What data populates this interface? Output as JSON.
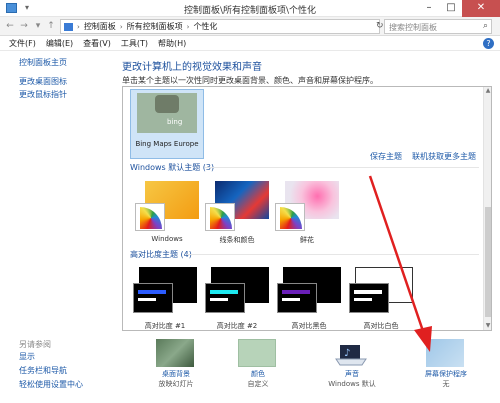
{
  "window": {
    "title": "控制面板\\所有控制面板项\\个性化"
  },
  "address": {
    "crumbs": [
      "控制面板",
      "所有控制面板项",
      "个性化"
    ],
    "search_placeholder": "搜索控制面板"
  },
  "menu": [
    "文件(F)",
    "编辑(E)",
    "查看(V)",
    "工具(T)",
    "帮助(H)"
  ],
  "sidebar": {
    "home": "控制面板主页",
    "links": [
      "更改桌面图标",
      "更改鼠标指针"
    ],
    "see_also_title": "另请参阅",
    "see_also": [
      "显示",
      "任务栏和导航",
      "轻松使用设置中心"
    ]
  },
  "main": {
    "heading": "更改计算机上的视觉效果和声音",
    "subheading": "单击某个主题以一次性同时更改桌面背景、颜色、声音和屏幕保护程序。",
    "my_theme": {
      "label": "Bing Maps Europe",
      "bing_text": "bing"
    },
    "actions": {
      "save": "保存主题",
      "online": "联机获取更多主题"
    },
    "default_section": "Windows 默认主题 (3)",
    "default_themes": [
      "Windows",
      "线条和颜色",
      "鲜花"
    ],
    "hc_section": "高对比度主题 (4)",
    "hc_themes": [
      "高对比度 #1",
      "高对比度 #2",
      "高对比黑色",
      "高对比白色"
    ]
  },
  "bottom": {
    "items": [
      {
        "title": "桌面背景",
        "sub": "放映幻灯片"
      },
      {
        "title": "颜色",
        "sub": "自定义"
      },
      {
        "title": "声音",
        "sub": "Windows 默认"
      },
      {
        "title": "屏幕保护程序",
        "sub": "无"
      }
    ]
  },
  "colors": {
    "accent_link": "#1e5aa8",
    "heading_blue": "#1b4f9c",
    "close_red": "#c75050",
    "arrow_red": "#e02020"
  }
}
